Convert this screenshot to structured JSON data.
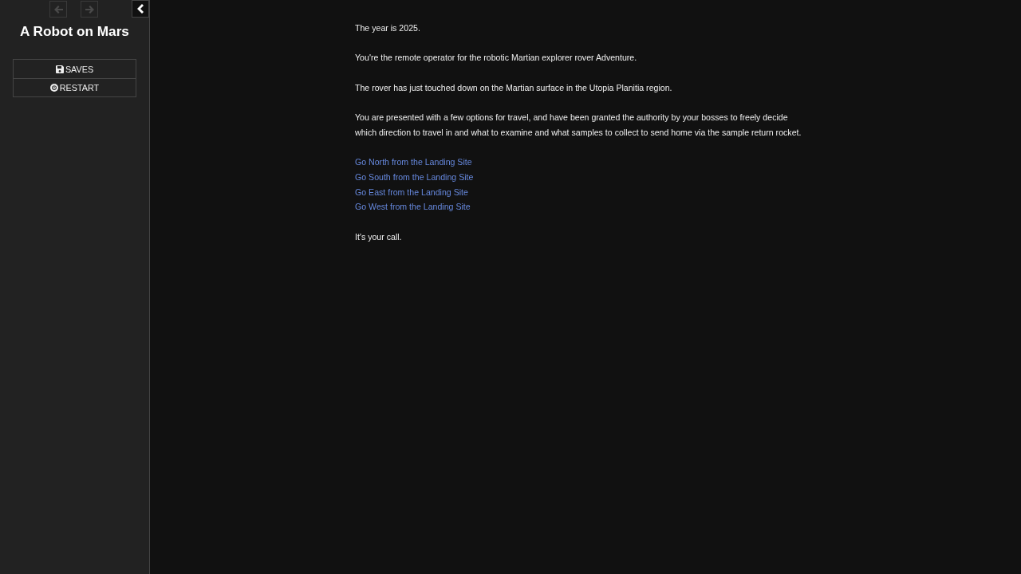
{
  "sidebar": {
    "history": [
      {
        "kind": "back",
        "disabled": true
      },
      {
        "kind": "forward",
        "disabled": true
      }
    ],
    "toggle": {
      "expanded": true
    },
    "title": "A Robot on Mars",
    "menu": [
      {
        "kind": "saves",
        "label": "SAVES"
      },
      {
        "kind": "restart",
        "label": "RESTART"
      }
    ]
  },
  "passage": {
    "paragraphs": [
      "The year is 2025.",
      "You're the remote operator for the robotic Martian explorer rover Adventure.",
      "The rover has just touched down on the Martian surface in the Utopia Planitia region.",
      "You are presented with a few options for travel, and have been granted the authority by your bosses to freely decide which direction to travel in and what to examine and what samples to collect to send home via the sample return rocket."
    ],
    "links": [
      "Go North from the Landing Site",
      "Go South from the Landing Site",
      "Go East from the Landing Site",
      "Go West from the Landing Site"
    ],
    "closing": "It's your call."
  }
}
